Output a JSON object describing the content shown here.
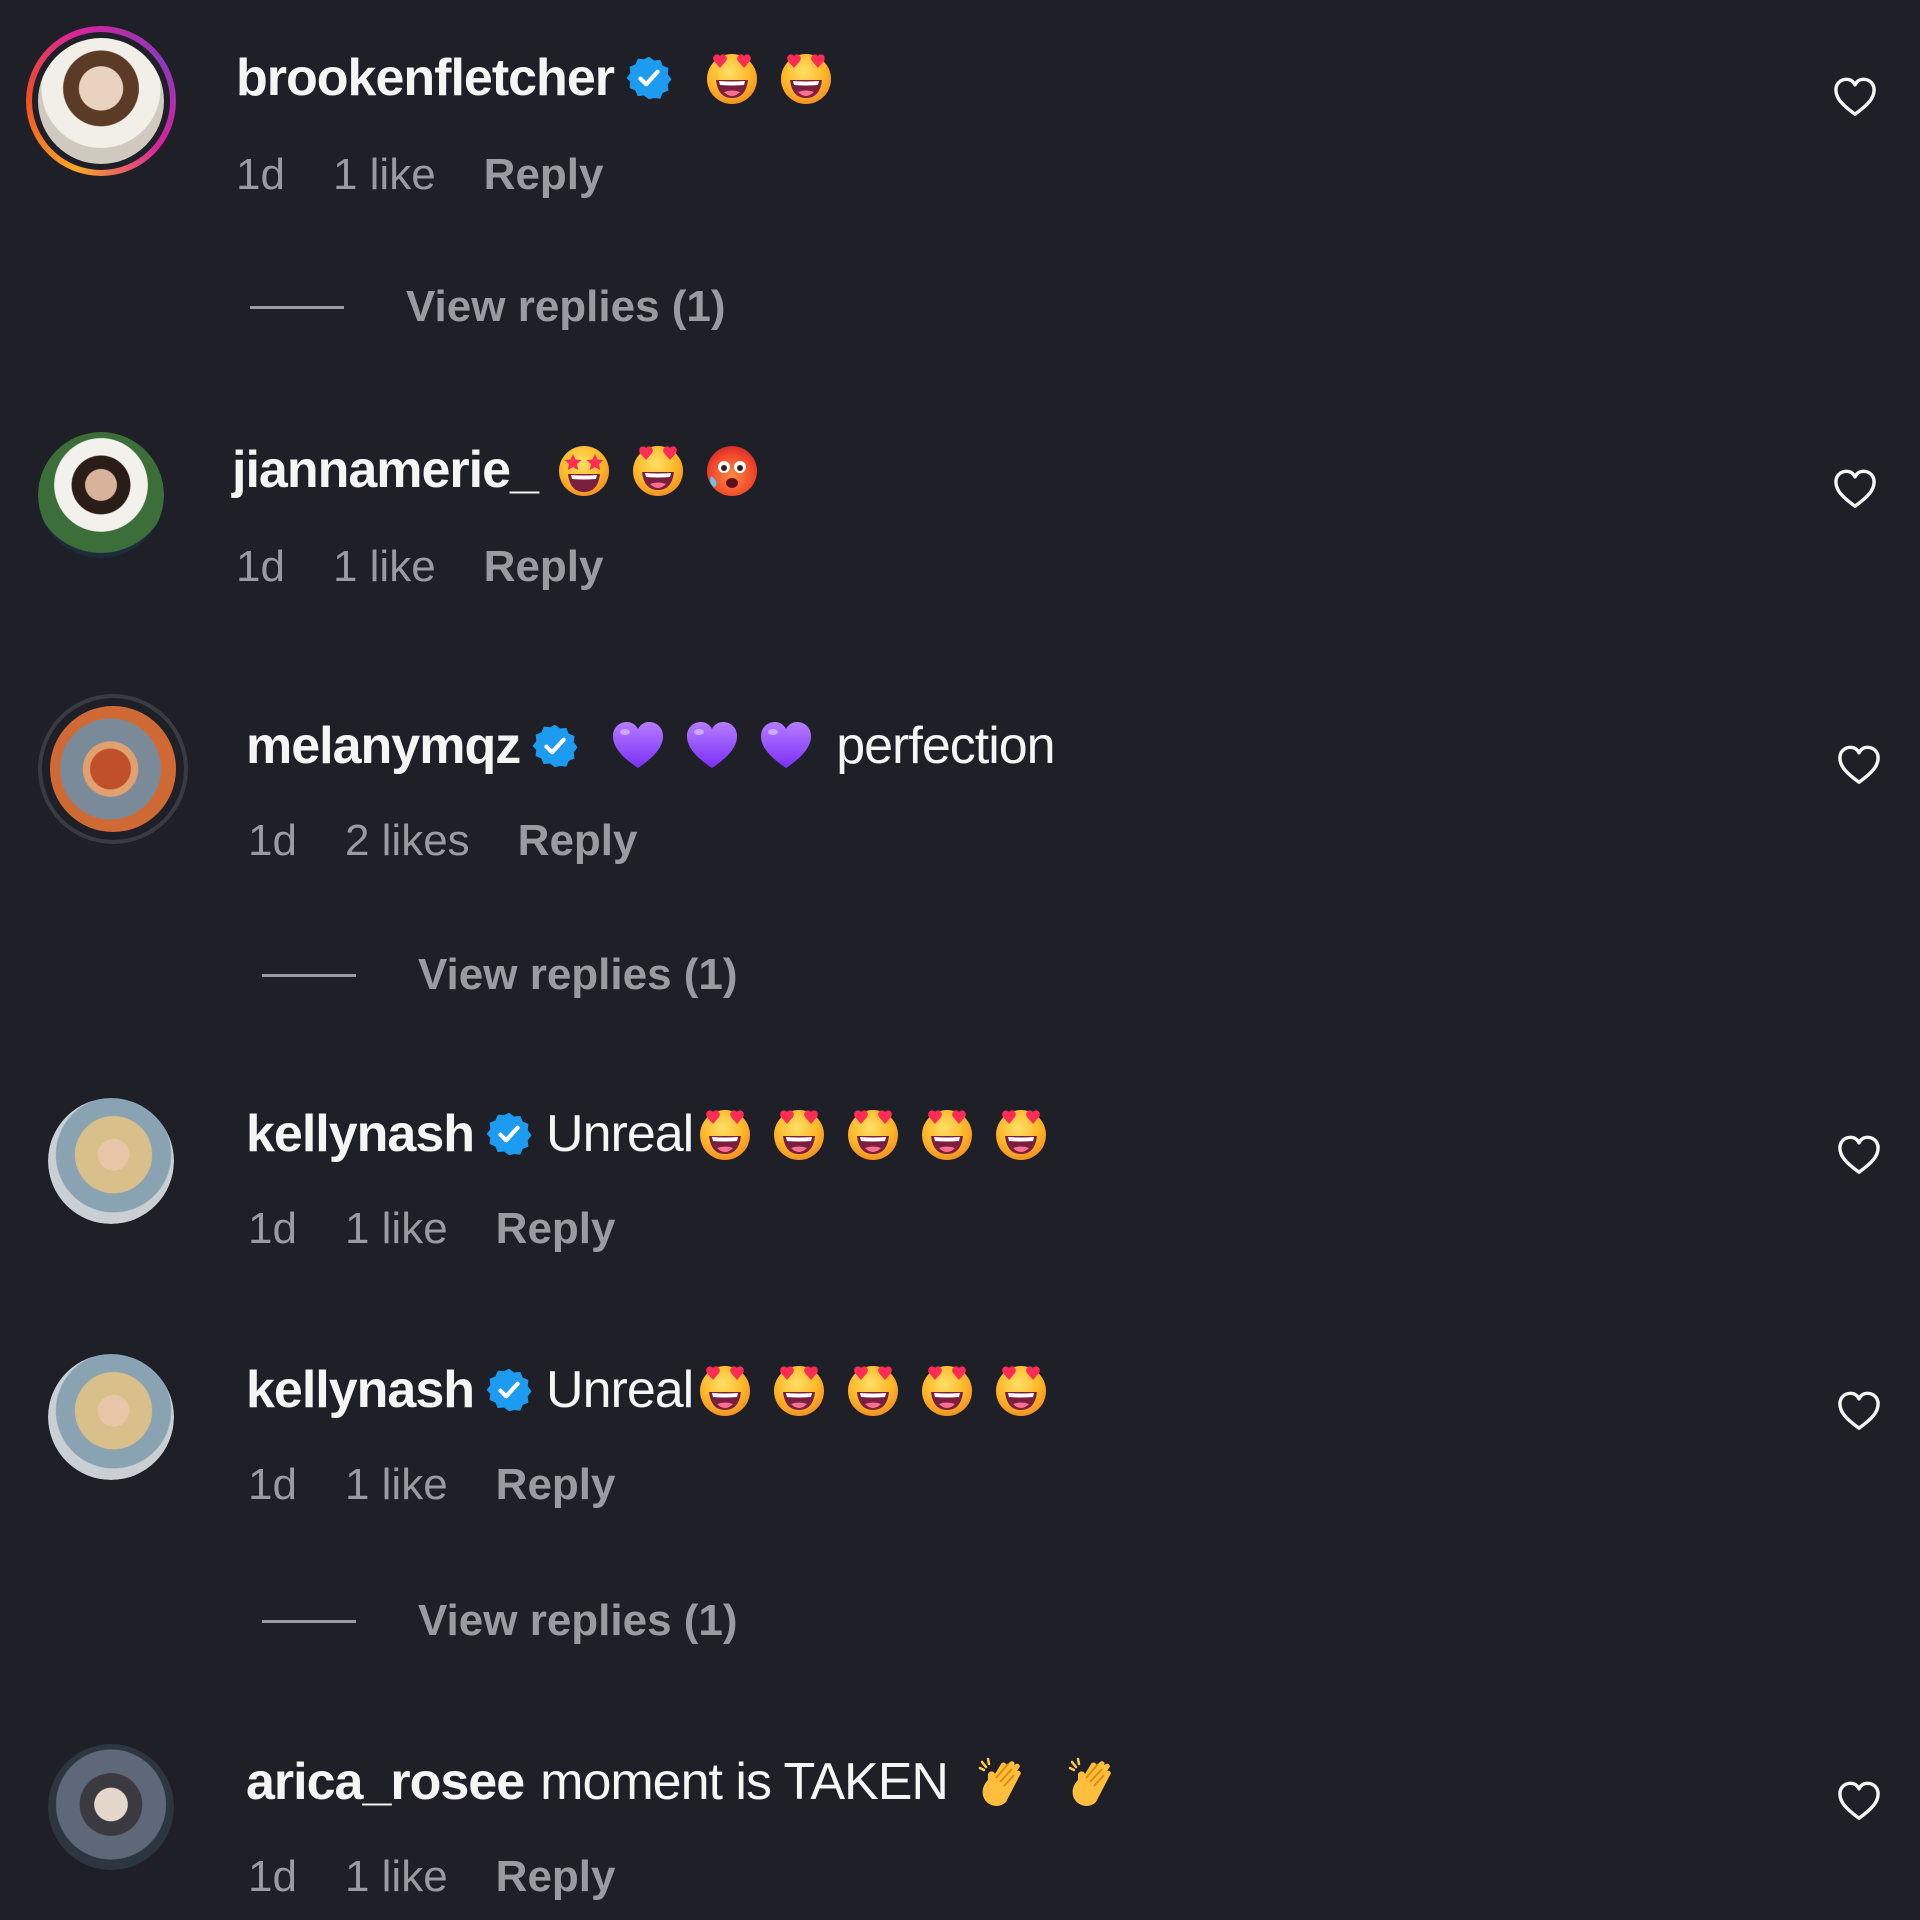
{
  "comments": [
    {
      "username": "brookenfletcher",
      "verified": true,
      "text": "",
      "emojis": [
        "heart-eyes-icon",
        "heart-eyes-icon"
      ],
      "age": "1d",
      "likes": "1 like",
      "reply": "Reply",
      "view_replies": "View replies (1)"
    },
    {
      "username": "jiannamerie_",
      "verified": false,
      "text": "",
      "emojis": [
        "star-struck-icon",
        "heart-eyes-icon",
        "hot-face-icon"
      ],
      "age": "1d",
      "likes": "1 like",
      "reply": "Reply"
    },
    {
      "username": "melanymqz",
      "verified": true,
      "text": "perfection",
      "emojis": [
        "purple-heart-icon",
        "purple-heart-icon",
        "purple-heart-icon"
      ],
      "age": "1d",
      "likes": "2 likes",
      "reply": "Reply",
      "view_replies": "View replies (1)"
    },
    {
      "username": "kellynash",
      "verified": true,
      "text": "Unreal",
      "emojis": [
        "heart-eyes-icon",
        "heart-eyes-icon",
        "heart-eyes-icon",
        "heart-eyes-icon",
        "heart-eyes-icon"
      ],
      "age": "1d",
      "likes": "1 like",
      "reply": "Reply"
    },
    {
      "username": "kellynash",
      "verified": true,
      "text": "Unreal",
      "emojis": [
        "heart-eyes-icon",
        "heart-eyes-icon",
        "heart-eyes-icon",
        "heart-eyes-icon",
        "heart-eyes-icon"
      ],
      "age": "1d",
      "likes": "1 like",
      "reply": "Reply",
      "view_replies": "View replies (1)"
    },
    {
      "username": "arica_rosee",
      "verified": false,
      "text": "moment is TAKEN",
      "emojis": [
        "clapping-hands-icon",
        "clapping-hands-icon"
      ],
      "age": "1d",
      "likes": "1 like",
      "reply": "Reply"
    }
  ],
  "colors": {
    "background": "#1f2027",
    "primary_text": "#f5f5f5",
    "secondary_text": "#9a9ba1",
    "verified_blue": "#1d9bf0"
  }
}
